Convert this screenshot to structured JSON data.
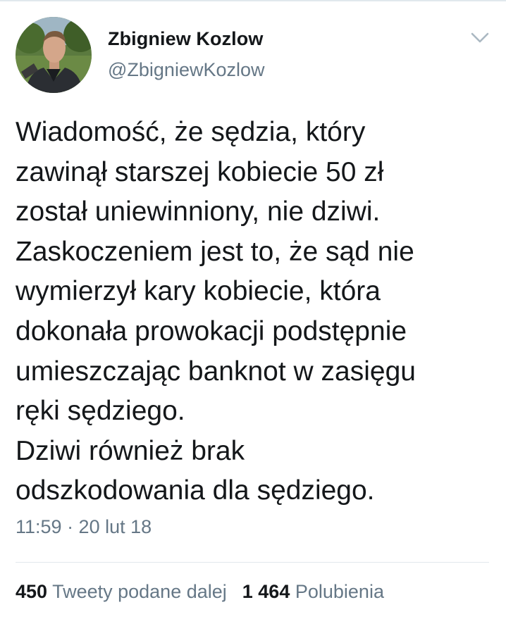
{
  "profile": {
    "display_name": "Zbigniew Kozlow",
    "handle": "@ZbigniewKozlow"
  },
  "tweet": {
    "lines": [
      "Wiadomość, że sędzia, który",
      "zawinął starszej kobiecie 50 zł",
      "został uniewinniony, nie dziwi.",
      "Zaskoczeniem jest to, że sąd nie",
      "wymierzył kary kobiecie, która",
      "dokonała prowokacji podstępnie",
      "umieszczając banknot w zasięgu",
      "ręki sędziego.",
      "Dziwi również brak",
      "odszkodowania dla sędziego."
    ],
    "timestamp": "11:59 · 20 lut 18"
  },
  "stats": {
    "retweets_count": "450",
    "retweets_label": "Tweety podane dalej",
    "likes_count": "1 464",
    "likes_label": "Polubienia"
  },
  "icons": {
    "menu": "chevron-down-icon"
  },
  "colors": {
    "text_primary": "#14171a",
    "text_secondary": "#657786",
    "divider": "#e1e8ed",
    "chevron": "#aab8c2"
  }
}
